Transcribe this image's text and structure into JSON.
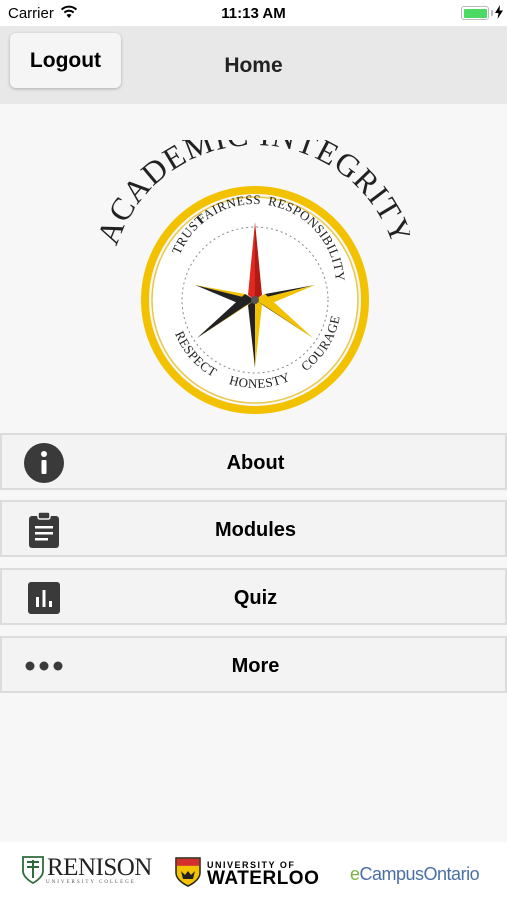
{
  "status_bar": {
    "carrier": "Carrier",
    "time": "11:13 AM"
  },
  "nav": {
    "logout_label": "Logout",
    "title": "Home"
  },
  "logo": {
    "arc_title": "ACADEMIC INTEGRITY",
    "values": [
      "FAIRNESS",
      "RESPONSIBILITY",
      "COURAGE",
      "HONESTY",
      "RESPECT",
      "TRUST"
    ]
  },
  "menu": {
    "items": [
      {
        "label": "About",
        "icon": "info-icon"
      },
      {
        "label": "Modules",
        "icon": "clipboard-icon"
      },
      {
        "label": "Quiz",
        "icon": "bar-chart-icon"
      },
      {
        "label": "More",
        "icon": "more-dots-icon"
      }
    ]
  },
  "footer": {
    "renison": "RENISON",
    "renison_sub": "UNIVERSITY COLLEGE",
    "waterloo_small": "UNIVERSITY OF",
    "waterloo_big": "WATERLOO",
    "ecampus_e": "e",
    "ecampus_campus": "Campus",
    "ecampus_ontario": "Ontario"
  },
  "colors": {
    "nav_bg": "#e8e8e8",
    "icon_dark": "#3a3a3a",
    "logo_gold": "#f2c200",
    "compass_red": "#e0281e",
    "battery_green": "#4cd964"
  }
}
